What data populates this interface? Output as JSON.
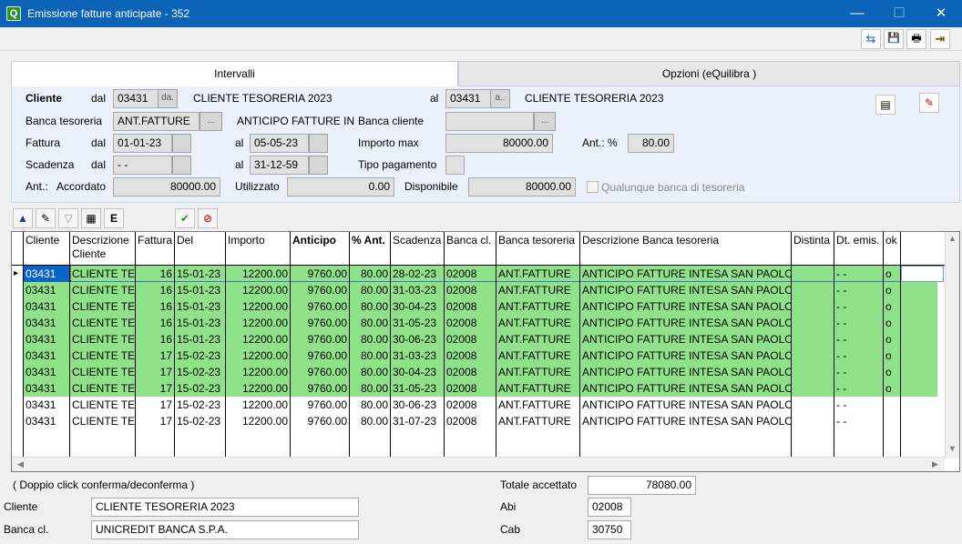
{
  "window": {
    "title": "Emissione fatture anticipate - 352",
    "minimize": "—",
    "maximize": "☐",
    "close": "✕"
  },
  "toolbar": {
    "refresh": "⇆",
    "save": "💾",
    "print": "🖶",
    "exit": "⇥"
  },
  "tabs": [
    {
      "label": "Intervalli",
      "active": true
    },
    {
      "label": "Opzioni (eQuilibra )",
      "active": false
    }
  ],
  "form": {
    "cliente_label": "Cliente",
    "dal_label": "dal",
    "al_label": "al",
    "cliente_dal_code": "03431",
    "cliente_dal_btn": "da.",
    "cliente_dal_name": "CLIENTE TESORERIA 2023",
    "cliente_al_code": "03431",
    "cliente_al_btn": "a..",
    "cliente_al_name": "CLIENTE TESORERIA 2023",
    "banca_tesoreria_label": "Banca tesoreria",
    "banca_tesoreria_value": "ANT.FATTURE",
    "banca_tesoreria_btn": "...",
    "banca_tesoreria_desc": "ANTICIPO FATTURE IN",
    "banca_cliente_label": "Banca cliente",
    "banca_cliente_value": "",
    "banca_cliente_btn": "...",
    "fattura_label": "Fattura",
    "fattura_dal": "01-01-23",
    "fattura_al": "05-05-23",
    "importo_max_label": "Importo max",
    "importo_max_value": "80000.00",
    "ant_pct_label": "Ant.: %",
    "ant_pct_value": "80.00",
    "scadenza_label": "Scadenza",
    "scadenza_dal": "- -",
    "scadenza_al": "31-12-59",
    "tipo_pagamento_label": "Tipo pagamento",
    "ant_label": "Ant.:",
    "accordato_label": "Accordato",
    "accordato_value": "80000.00",
    "utilizzato_label": "Utilizzato",
    "utilizzato_value": "0.00",
    "disponibile_label": "Disponibile",
    "disponibile_value": "80000.00",
    "qualunque_label": "Qualunque banca di tesoreria"
  },
  "grid": {
    "columns": [
      "Cliente",
      "Descrizione Cliente",
      "Fattura",
      "Del",
      "Importo",
      "Anticipo",
      "% Ant.",
      "Scadenza",
      "Banca cl.",
      "Banca tesoreria",
      "Descrizione Banca tesoreria",
      "Distinta",
      "Dt. emis.",
      "ok"
    ],
    "rows": [
      {
        "cliente": "03431",
        "descr": "CLIENTE TE",
        "fattura": "16",
        "del": "15-01-23",
        "importo": "12200.00",
        "anticipo": "9760.00",
        "pct": "80.00",
        "scadenza": "28-02-23",
        "banca_cl": "02008",
        "banca_tes": "ANT.FATTURE",
        "descr_banca": "ANTICIPO FATTURE INTESA SAN PAOLO",
        "distinta": "",
        "dt_emis": "- -",
        "ok": "o",
        "selected": true
      },
      {
        "cliente": "03431",
        "descr": "CLIENTE TE",
        "fattura": "16",
        "del": "15-01-23",
        "importo": "12200.00",
        "anticipo": "9760.00",
        "pct": "80.00",
        "scadenza": "31-03-23",
        "banca_cl": "02008",
        "banca_tes": "ANT.FATTURE",
        "descr_banca": "ANTICIPO FATTURE INTESA SAN PAOLO",
        "distinta": "",
        "dt_emis": "- -",
        "ok": "o",
        "selected": true
      },
      {
        "cliente": "03431",
        "descr": "CLIENTE TE",
        "fattura": "16",
        "del": "15-01-23",
        "importo": "12200.00",
        "anticipo": "9760.00",
        "pct": "80.00",
        "scadenza": "30-04-23",
        "banca_cl": "02008",
        "banca_tes": "ANT.FATTURE",
        "descr_banca": "ANTICIPO FATTURE INTESA SAN PAOLO",
        "distinta": "",
        "dt_emis": "- -",
        "ok": "o",
        "selected": true
      },
      {
        "cliente": "03431",
        "descr": "CLIENTE TE",
        "fattura": "16",
        "del": "15-01-23",
        "importo": "12200.00",
        "anticipo": "9760.00",
        "pct": "80.00",
        "scadenza": "31-05-23",
        "banca_cl": "02008",
        "banca_tes": "ANT.FATTURE",
        "descr_banca": "ANTICIPO FATTURE INTESA SAN PAOLO",
        "distinta": "",
        "dt_emis": "- -",
        "ok": "o",
        "selected": true
      },
      {
        "cliente": "03431",
        "descr": "CLIENTE TE",
        "fattura": "16",
        "del": "15-01-23",
        "importo": "12200.00",
        "anticipo": "9760.00",
        "pct": "80.00",
        "scadenza": "30-06-23",
        "banca_cl": "02008",
        "banca_tes": "ANT.FATTURE",
        "descr_banca": "ANTICIPO FATTURE INTESA SAN PAOLO",
        "distinta": "",
        "dt_emis": "- -",
        "ok": "o",
        "selected": true
      },
      {
        "cliente": "03431",
        "descr": "CLIENTE TE",
        "fattura": "17",
        "del": "15-02-23",
        "importo": "12200.00",
        "anticipo": "9760.00",
        "pct": "80.00",
        "scadenza": "31-03-23",
        "banca_cl": "02008",
        "banca_tes": "ANT.FATTURE",
        "descr_banca": "ANTICIPO FATTURE INTESA SAN PAOLO",
        "distinta": "",
        "dt_emis": "- -",
        "ok": "o",
        "selected": true
      },
      {
        "cliente": "03431",
        "descr": "CLIENTE TE",
        "fattura": "17",
        "del": "15-02-23",
        "importo": "12200.00",
        "anticipo": "9760.00",
        "pct": "80.00",
        "scadenza": "30-04-23",
        "banca_cl": "02008",
        "banca_tes": "ANT.FATTURE",
        "descr_banca": "ANTICIPO FATTURE INTESA SAN PAOLO",
        "distinta": "",
        "dt_emis": "- -",
        "ok": "o",
        "selected": true
      },
      {
        "cliente": "03431",
        "descr": "CLIENTE TE",
        "fattura": "17",
        "del": "15-02-23",
        "importo": "12200.00",
        "anticipo": "9760.00",
        "pct": "80.00",
        "scadenza": "31-05-23",
        "banca_cl": "02008",
        "banca_tes": "ANT.FATTURE",
        "descr_banca": "ANTICIPO FATTURE INTESA SAN PAOLO",
        "distinta": "",
        "dt_emis": "- -",
        "ok": "o",
        "selected": true
      },
      {
        "cliente": "03431",
        "descr": "CLIENTE TE",
        "fattura": "17",
        "del": "15-02-23",
        "importo": "12200.00",
        "anticipo": "9760.00",
        "pct": "80.00",
        "scadenza": "30-06-23",
        "banca_cl": "02008",
        "banca_tes": "ANT.FATTURE",
        "descr_banca": "ANTICIPO FATTURE INTESA SAN PAOLO",
        "distinta": "",
        "dt_emis": "- -",
        "ok": "",
        "selected": false
      },
      {
        "cliente": "03431",
        "descr": "CLIENTE TE",
        "fattura": "17",
        "del": "15-02-23",
        "importo": "12200.00",
        "anticipo": "9760.00",
        "pct": "80.00",
        "scadenza": "31-07-23",
        "banca_cl": "02008",
        "banca_tes": "ANT.FATTURE",
        "descr_banca": "ANTICIPO FATTURE INTESA SAN PAOLO",
        "distinta": "",
        "dt_emis": "- -",
        "ok": "",
        "selected": false
      }
    ]
  },
  "footer": {
    "hint": "( Doppio click conferma/deconferma )",
    "cliente_label": "Cliente",
    "cliente_value": "CLIENTE TESORERIA 2023",
    "banca_cl_label": "Banca cl.",
    "banca_cl_value": "UNICREDIT BANCA S.P.A.",
    "totale_label": "Totale accettato",
    "totale_value": "78080.00",
    "abi_label": "Abi",
    "abi_value": "02008",
    "cab_label": "Cab",
    "cab_value": "30750"
  },
  "colors": {
    "selected_row": "#90e28a",
    "title_bar": "#0a63b7"
  }
}
